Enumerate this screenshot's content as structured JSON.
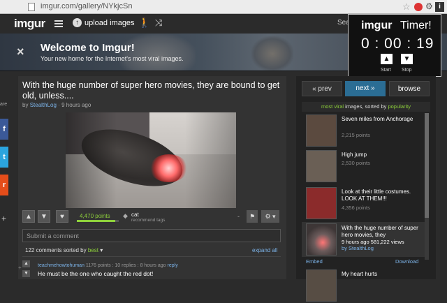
{
  "browser": {
    "url": "imgur.com/gallery/NYkjcSn"
  },
  "nav": {
    "logo": "imgur",
    "upload_label": "upload images",
    "search_label": "Sear"
  },
  "banner": {
    "close": "×",
    "title": "Welcome to Imgur!",
    "subtitle": "Your new home for the Internet's most viral images."
  },
  "timer": {
    "logo": "imgur",
    "word": "Timer!",
    "time": "0 : 00 : 19",
    "start_label": "Start",
    "stop_label": "Stop"
  },
  "share": {
    "label": "are",
    "facebook": "f",
    "twitter": "t",
    "reddit": "r",
    "more": "+"
  },
  "post": {
    "title": "With the huge number of super hero movies, they are bound to get old, unless....",
    "by_prefix": "by",
    "author": "StealthLog",
    "time_ago": "· 9 hours ago",
    "points": "4,470 points",
    "points_ratio": 0.92,
    "tag": "cat",
    "tag_sub": "recommend tags",
    "dash": "-"
  },
  "comments": {
    "placeholder": "Submit a comment",
    "count_text": "122 comments sorted by",
    "sort": "best",
    "expand": "expand all",
    "first": {
      "user": "teachmehowtohuman",
      "meta": "1176 points : 10 replies : 8 hours ago",
      "reply": "reply",
      "text": "He must be the one who caught the red dot!"
    }
  },
  "sidebar": {
    "prev": "« prev",
    "next": "next »",
    "browse": "browse",
    "mv_prefix": "most viral",
    "mv_mid": "images, sorted by",
    "mv_sort": "popularity",
    "items": [
      {
        "title": "Seven miles from Anchorage",
        "views": "2,215 points",
        "thumb": "#5b4a3f"
      },
      {
        "title": "High jump",
        "views": "2,530 points",
        "thumb": "#6a5f55"
      },
      {
        "title": "Look at their little costumes. LOOK AT THEM!!!",
        "views": "4,356 points",
        "thumb": "#8b2b2b"
      },
      {
        "title": "With the huge number of super hero movies, they",
        "views": "9 hours ago   581,222 views",
        "by": "by StealthLog",
        "thumb": "#4b4444"
      },
      {
        "title": "My heart hurts",
        "views": "",
        "thumb": "#574d44"
      }
    ],
    "embed": "Embed",
    "download": "Download"
  }
}
